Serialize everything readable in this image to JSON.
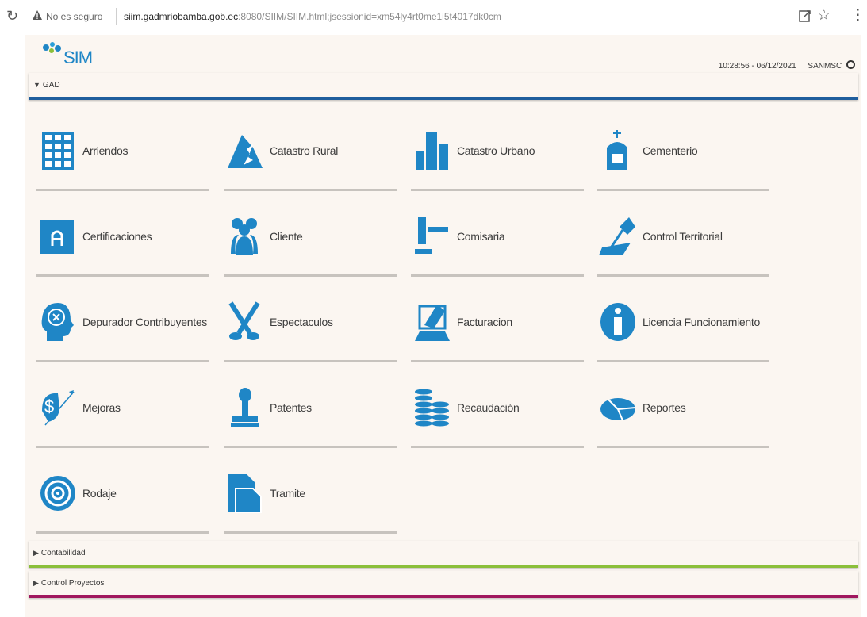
{
  "browser": {
    "security_label": "No es seguro",
    "url_host": "siim.gadmriobamba.gob.ec",
    "url_rest": ":8080/SIIM/SIIM.html;jsessionid=xm54ly4rt0me1i5t4017dk0cm"
  },
  "app": {
    "logo": "SIM",
    "datetime": "10:28:56 - 06/12/2021",
    "user": "SANMSC"
  },
  "sections": {
    "gad": "GAD",
    "contabilidad": "Contabilidad",
    "control_proyectos": "Control Proyectos"
  },
  "modules": [
    {
      "label": "Arriendos",
      "icon": "grid-building-icon"
    },
    {
      "label": "Catastro Rural",
      "icon": "mountain-icon"
    },
    {
      "label": "Catastro Urbano",
      "icon": "skyscraper-icon"
    },
    {
      "label": "Cementerio",
      "icon": "grave-icon"
    },
    {
      "label": "Certificaciones",
      "icon": "certificate-icon"
    },
    {
      "label": "Cliente",
      "icon": "people-icon"
    },
    {
      "label": "Comisaria",
      "icon": "gavel-icon"
    },
    {
      "label": "Control Territorial",
      "icon": "pin-map-icon"
    },
    {
      "label": "Depurador Contribuyentes",
      "icon": "head-x-icon"
    },
    {
      "label": "Espectaculos",
      "icon": "scissors-icon"
    },
    {
      "label": "Facturacion",
      "icon": "invoice-laptop-icon"
    },
    {
      "label": "Licencia Funcionamiento",
      "icon": "info-icon"
    },
    {
      "label": "Mejoras",
      "icon": "dollar-growth-icon"
    },
    {
      "label": "Patentes",
      "icon": "stamp-icon"
    },
    {
      "label": "Recaudación",
      "icon": "coin-stack-icon"
    },
    {
      "label": "Reportes",
      "icon": "pie-chart-icon"
    },
    {
      "label": "Rodaje",
      "icon": "wheel-icon"
    },
    {
      "label": "Tramite",
      "icon": "documents-icon"
    }
  ],
  "colors": {
    "accent_blue": "#1f86c6",
    "gad_bar": "#1f5e9d",
    "contabilidad_bar": "#8bbf3a",
    "proyectos_bar": "#a0175e"
  }
}
